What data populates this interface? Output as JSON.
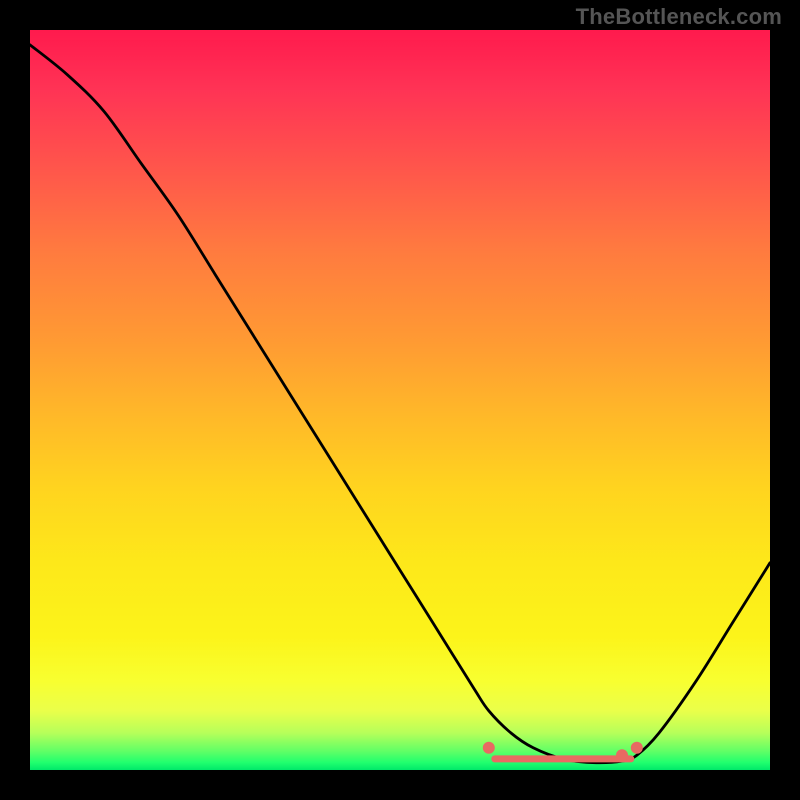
{
  "watermark": "TheBottleneck.com",
  "colors": {
    "background_frame": "#000000",
    "curve": "#000000",
    "marker": "#e86a62",
    "gradient_top": "#ff1a4d",
    "gradient_bottom": "#00e86a"
  },
  "chart_data": {
    "type": "line",
    "title": "",
    "xlabel": "",
    "ylabel": "",
    "x": [
      0,
      5,
      10,
      15,
      20,
      25,
      30,
      35,
      40,
      45,
      50,
      55,
      60,
      62,
      65,
      68,
      72,
      76,
      80,
      82,
      85,
      90,
      95,
      100
    ],
    "values": [
      98,
      94,
      89,
      82,
      75,
      67,
      59,
      51,
      43,
      35,
      27,
      19,
      11,
      8,
      5,
      3,
      1.5,
      1,
      1.2,
      2,
      5,
      12,
      20,
      28
    ],
    "xlim": [
      0,
      100
    ],
    "ylim": [
      0,
      100
    ],
    "optimal_zone": {
      "x_start": 62,
      "x_end": 82,
      "y": 1.5
    },
    "markers": [
      {
        "x": 62,
        "y": 3
      },
      {
        "x": 80,
        "y": 2
      },
      {
        "x": 82,
        "y": 3
      }
    ],
    "annotations": []
  }
}
